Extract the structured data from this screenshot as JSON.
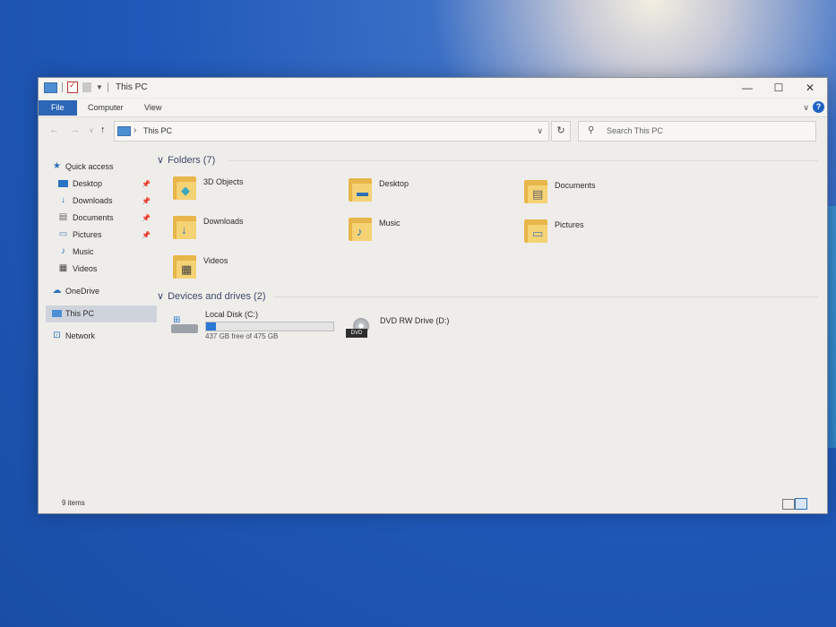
{
  "window": {
    "title": "This PC"
  },
  "ribbon": {
    "tabs": [
      "File",
      "Computer",
      "View"
    ]
  },
  "address": {
    "path": "This PC",
    "search_placeholder": "Search This PC"
  },
  "sidebar": {
    "quick_access": "Quick access",
    "quick_items": [
      {
        "label": "Desktop",
        "icon": "desktop-icon",
        "pinned": true
      },
      {
        "label": "Downloads",
        "icon": "downloads-icon",
        "pinned": true
      },
      {
        "label": "Documents",
        "icon": "documents-icon",
        "pinned": true
      },
      {
        "label": "Pictures",
        "icon": "pictures-icon",
        "pinned": true
      },
      {
        "label": "Music",
        "icon": "music-icon",
        "pinned": false
      },
      {
        "label": "Videos",
        "icon": "videos-icon",
        "pinned": false
      }
    ],
    "onedrive": "OneDrive",
    "this_pc": "This PC",
    "network": "Network"
  },
  "folders": {
    "header": "Folders (7)",
    "items": [
      {
        "label": "3D Objects",
        "icon": "3d-objects-folder-icon"
      },
      {
        "label": "Desktop",
        "icon": "desktop-folder-icon"
      },
      {
        "label": "Documents",
        "icon": "documents-folder-icon"
      },
      {
        "label": "Downloads",
        "icon": "downloads-folder-icon"
      },
      {
        "label": "Music",
        "icon": "music-folder-icon"
      },
      {
        "label": "Pictures",
        "icon": "pictures-folder-icon"
      },
      {
        "label": "Videos",
        "icon": "videos-folder-icon"
      }
    ]
  },
  "devices": {
    "header": "Devices and drives (2)",
    "items": [
      {
        "label": "Local Disk (C:)",
        "detail": "437 GB free of 475 GB",
        "used_fraction": 0.08,
        "icon": "hard-drive-icon"
      },
      {
        "label": "DVD RW Drive (D:)",
        "icon": "dvd-drive-icon",
        "icon_text": "DVD"
      }
    ]
  },
  "status": {
    "items_count": "9 items"
  },
  "colors": {
    "accent": "#2c66b6",
    "folder": "#e8b64a",
    "drive_bar": "#2a79d6"
  }
}
